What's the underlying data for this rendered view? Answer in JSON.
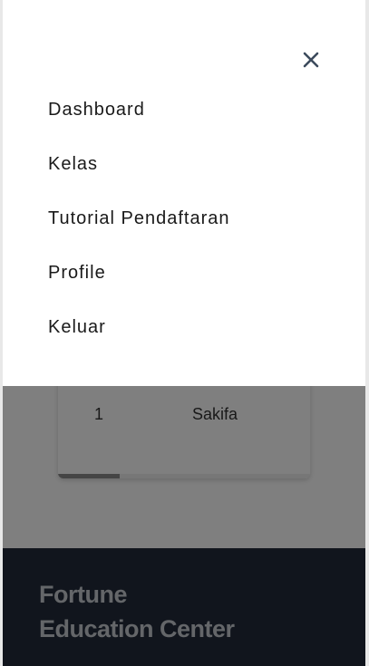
{
  "drawer": {
    "close_icon": "close-icon",
    "menu": [
      {
        "label": "Dashboard"
      },
      {
        "label": "Kelas"
      },
      {
        "label": "Tutorial Pendaftaran"
      },
      {
        "label": "Profile"
      },
      {
        "label": "Keluar"
      }
    ]
  },
  "table": {
    "rows": [
      {
        "no": "1",
        "name": "Sakifa"
      }
    ]
  },
  "footer": {
    "title_line1": "Fortune",
    "title_line2": "Education Center"
  },
  "colors": {
    "footer_bg": "#222b3b",
    "overlay": "rgba(0,0,0,0.5)",
    "menu_text": "#1a1a1a"
  }
}
